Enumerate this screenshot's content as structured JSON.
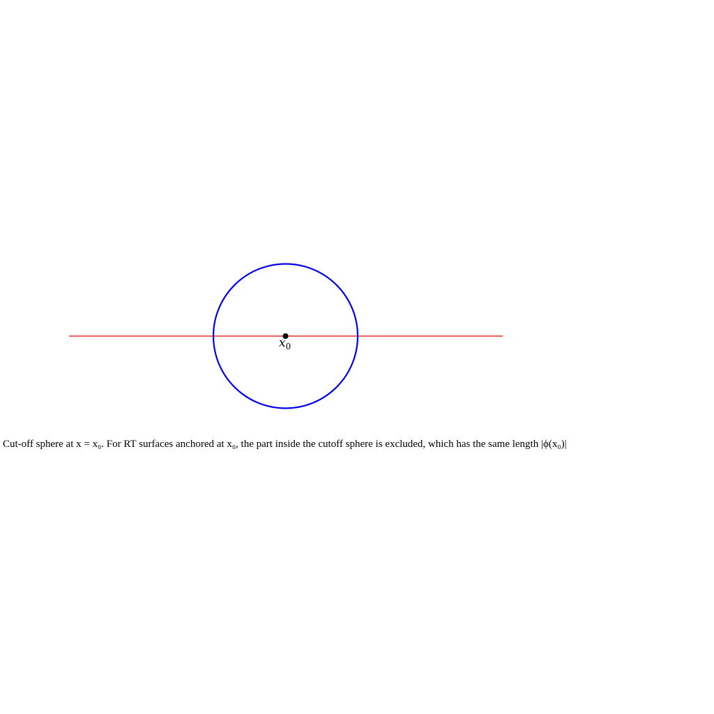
{
  "diagram": {
    "point_label": {
      "base": "x",
      "subscript": "0"
    },
    "colors": {
      "line": "#e00000",
      "circle": "#0000ee",
      "point": "#000000",
      "background": "#ffffff"
    },
    "elements": [
      {
        "kind": "horizontal-line",
        "meaning": "RT surface",
        "color": "red"
      },
      {
        "kind": "circle",
        "meaning": "cut-off sphere",
        "color": "blue"
      },
      {
        "kind": "point",
        "meaning": "anchor point",
        "label": "x_0"
      }
    ]
  },
  "caption": {
    "text": "Cut-off sphere at x = x₀. For RT surfaces anchored at x₀, the part inside the cutoff sphere is excluded, which has the same length |ϕ(x₀)|"
  }
}
